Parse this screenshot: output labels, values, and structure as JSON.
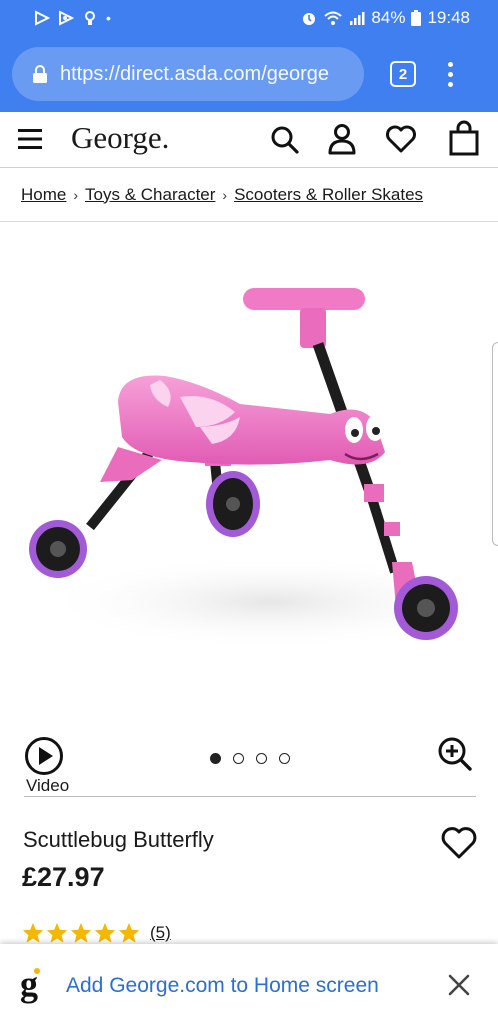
{
  "status_bar": {
    "battery": "84%",
    "time": "19:48"
  },
  "browser": {
    "url": "https://direct.asda.com/george",
    "tab_count": "2"
  },
  "site": {
    "logo": "George."
  },
  "breadcrumb": [
    "Home",
    "Toys & Character",
    "Scooters & Roller Skates"
  ],
  "media": {
    "video_label": "Video",
    "image_count": 4,
    "active_image": 1
  },
  "product": {
    "title": "Scuttlebug Butterfly",
    "price": "£27.97",
    "rating": 5,
    "review_count": "(5)"
  },
  "banner": {
    "logo_letter": "g",
    "text": "Add George.com to Home screen"
  },
  "colors": {
    "chrome": "#3f7ff0",
    "product_pink": "#f07ac6",
    "wheel_purple": "#a25ad6",
    "star": "#f5b800",
    "banner_link": "#2a6fd6"
  }
}
